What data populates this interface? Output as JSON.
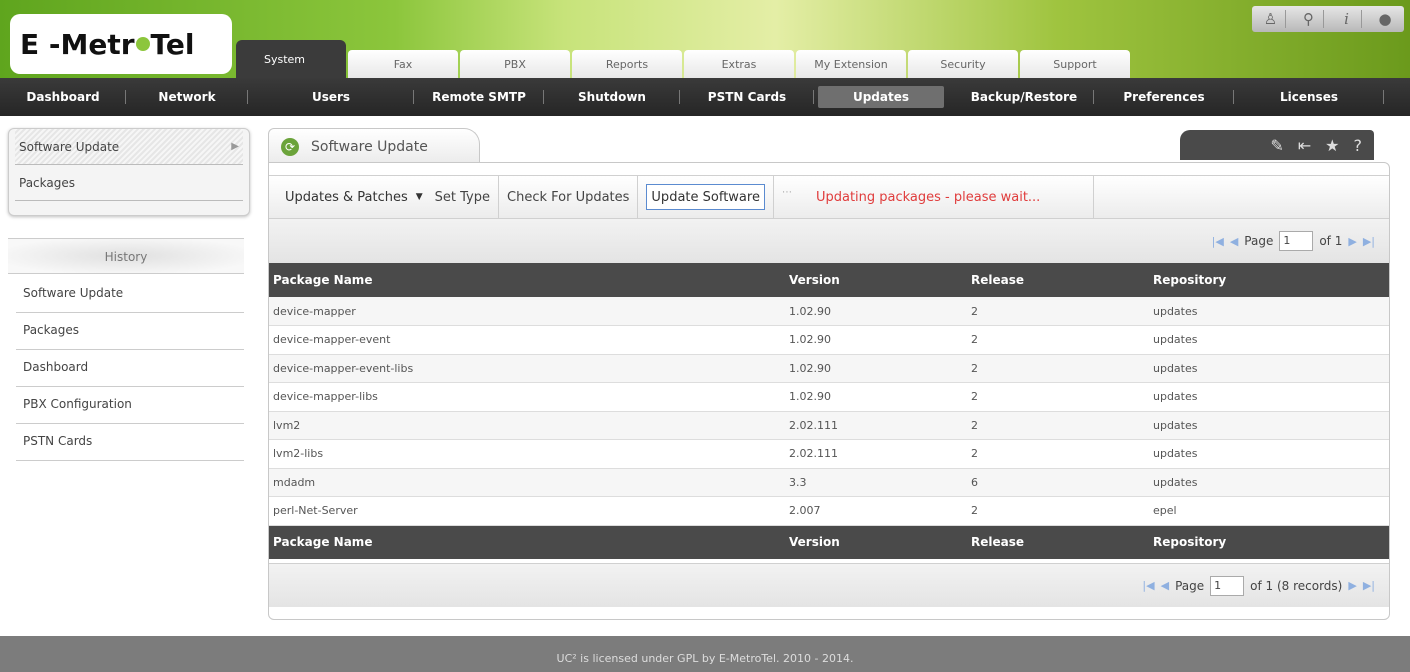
{
  "app": {
    "logo_text": "E-MetroTel",
    "top_icons": [
      "user-icon",
      "search-icon",
      "info-icon",
      "drop-icon"
    ]
  },
  "tabs": [
    {
      "label": "System",
      "active": true
    },
    {
      "label": "Fax"
    },
    {
      "label": "PBX"
    },
    {
      "label": "Reports"
    },
    {
      "label": "Extras"
    },
    {
      "label": "My Extension"
    },
    {
      "label": "Security"
    },
    {
      "label": "Support"
    }
  ],
  "nav": [
    {
      "label": "Dashboard"
    },
    {
      "label": "Network"
    },
    {
      "label": "Users"
    },
    {
      "label": "Remote SMTP"
    },
    {
      "label": "Shutdown"
    },
    {
      "label": "PSTN Cards"
    },
    {
      "label": "Updates",
      "active": true
    },
    {
      "label": "Backup/Restore"
    },
    {
      "label": "Preferences"
    },
    {
      "label": "Licenses"
    }
  ],
  "sidebar": {
    "items": [
      {
        "label": "Software Update",
        "selected": true
      },
      {
        "label": "Packages"
      }
    ],
    "history_title": "History",
    "history": [
      {
        "label": "Software Update"
      },
      {
        "label": "Packages"
      },
      {
        "label": "Dashboard"
      },
      {
        "label": "PBX Configuration"
      },
      {
        "label": "PSTN Cards"
      }
    ]
  },
  "panel": {
    "title": "Software Update",
    "tools": [
      "edit-icon",
      "pin-icon",
      "star-icon",
      "help-icon"
    ]
  },
  "toolbar": {
    "select_value": "Updates & Patches",
    "set_type": "Set Type",
    "check_updates": "Check For Updates",
    "update_software": "Update Software",
    "status": "Updating packages - please wait..."
  },
  "pager_top": {
    "page_label": "Page",
    "page_value": "1",
    "of_label": "of 1"
  },
  "table": {
    "headers": [
      "Package Name",
      "Version",
      "Release",
      "Repository"
    ],
    "rows": [
      [
        "device-mapper",
        "1.02.90",
        "2",
        "updates"
      ],
      [
        "device-mapper-event",
        "1.02.90",
        "2",
        "updates"
      ],
      [
        "device-mapper-event-libs",
        "1.02.90",
        "2",
        "updates"
      ],
      [
        "device-mapper-libs",
        "1.02.90",
        "2",
        "updates"
      ],
      [
        "lvm2",
        "2.02.111",
        "2",
        "updates"
      ],
      [
        "lvm2-libs",
        "2.02.111",
        "2",
        "updates"
      ],
      [
        "mdadm",
        "3.3",
        "6",
        "updates"
      ],
      [
        "perl-Net-Server",
        "2.007",
        "2",
        "epel"
      ]
    ]
  },
  "pager_bottom": {
    "page_label": "Page",
    "page_value": "1",
    "of_label": "of 1 (8 records)"
  },
  "footer": {
    "text": "UC² is licensed under GPL by E-MetroTel. 2010 - 2014."
  },
  "colors": {
    "accent_green": "#8cc63c",
    "nav_dark": "#2e2e2e",
    "status_red": "#e03c3c"
  }
}
